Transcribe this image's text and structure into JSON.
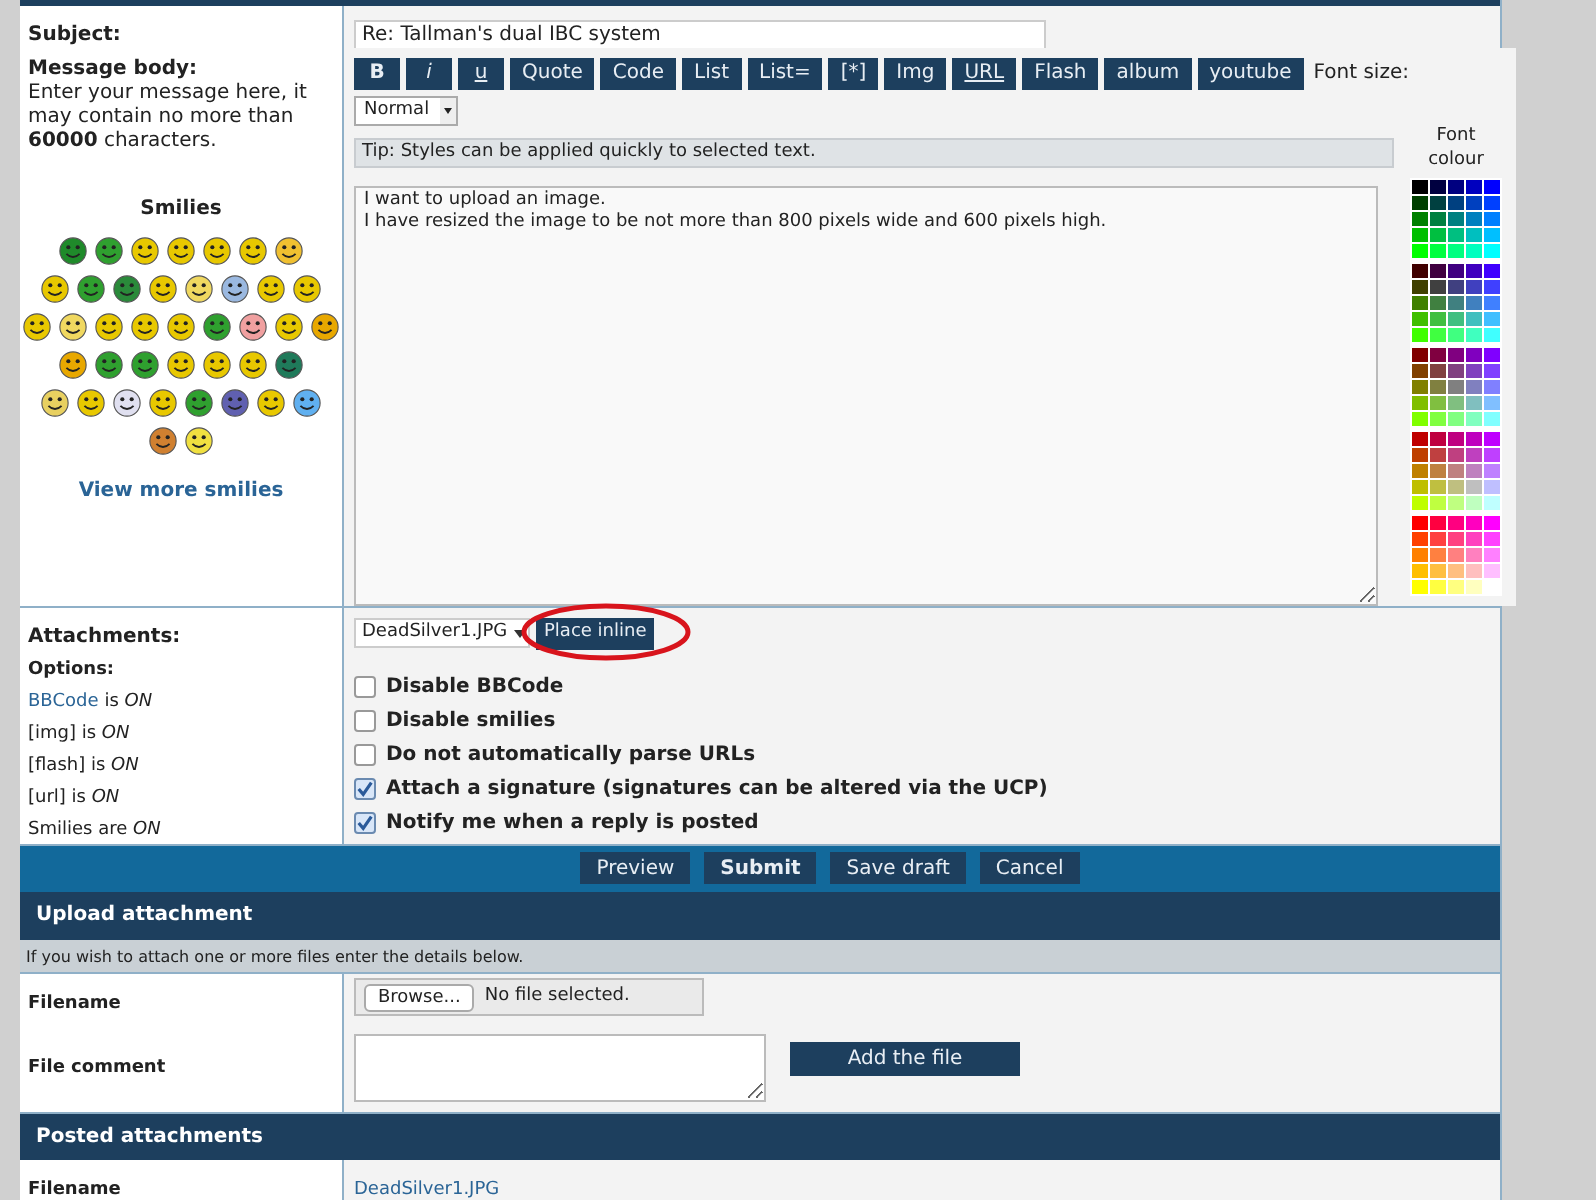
{
  "subject": {
    "label": "Subject:",
    "value": "Re: Tallman's dual IBC system"
  },
  "message_body": {
    "label": "Message body:",
    "hint": "Enter your message here, it may contain no more than **60000** characters.",
    "smilies_title": "Smilies",
    "view_more": "View more smilies",
    "toolbar": [
      {
        "label": "B",
        "kind": "bold"
      },
      {
        "label": "i",
        "kind": "italic"
      },
      {
        "label": "u",
        "kind": "underline"
      },
      {
        "label": "Quote",
        "kind": "plain"
      },
      {
        "label": "Code",
        "kind": "plain"
      },
      {
        "label": "List",
        "kind": "plain"
      },
      {
        "label": "List=",
        "kind": "plain"
      },
      {
        "label": "[*]",
        "kind": "plain"
      },
      {
        "label": "Img",
        "kind": "plain"
      },
      {
        "label": "URL",
        "kind": "underline"
      },
      {
        "label": "Flash",
        "kind": "plain"
      },
      {
        "label": "album",
        "kind": "plain"
      },
      {
        "label": "youtube",
        "kind": "plain"
      }
    ],
    "font_size": {
      "label": "Font size:",
      "value": "Normal"
    },
    "tip": "Tip: Styles can be applied quickly to selected text.",
    "font_colour_label": "Font colour",
    "text": "I want to upload an image.\nI have resized the image to be not more than 800 pixels wide and 600 pixels high."
  },
  "attachments": {
    "label": "Attachments:",
    "selected_file": "DeadSilver1.JPG",
    "place_inline": "Place inline"
  },
  "options": {
    "label": "Options:",
    "status": [
      {
        "link": "BBCode",
        "text": "is *ON*"
      },
      {
        "text": "[img] is *ON*"
      },
      {
        "text": "[flash] is *ON*"
      },
      {
        "text": "[url] is *ON*"
      },
      {
        "text": "Smilies are *ON*"
      }
    ],
    "checkboxes": [
      {
        "label": "Disable BBCode",
        "checked": false
      },
      {
        "label": "Disable smilies",
        "checked": false
      },
      {
        "label": "Do not automatically parse URLs",
        "checked": false
      },
      {
        "label": "Attach a signature (signatures can be altered via the UCP)",
        "checked": true
      },
      {
        "label": "Notify me when a reply is posted",
        "checked": true
      }
    ]
  },
  "actions": [
    {
      "label": "Preview",
      "kind": "normal"
    },
    {
      "label": "Submit",
      "kind": "primary"
    },
    {
      "label": "Save draft",
      "kind": "normal"
    },
    {
      "label": "Cancel",
      "kind": "normal"
    }
  ],
  "upload": {
    "title": "Upload attachment",
    "info": "If you wish to attach one or more files enter the details below.",
    "filename_label": "Filename",
    "browse": "Browse...",
    "no_file": "No file selected.",
    "comment_label": "File comment",
    "add_button": "Add the file"
  },
  "posted": {
    "title": "Posted attachments",
    "filename_label": "Filename",
    "file": "DeadSilver1.JPG"
  }
}
